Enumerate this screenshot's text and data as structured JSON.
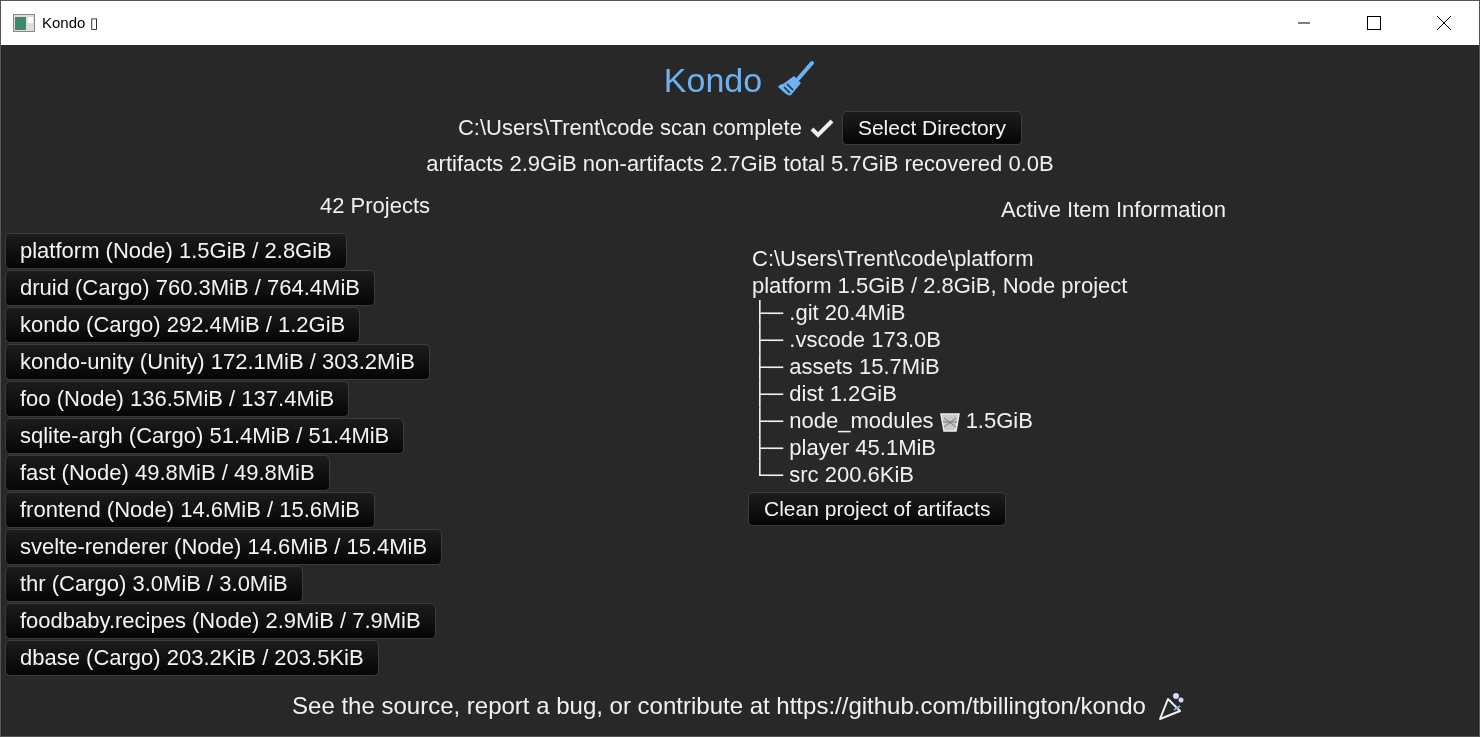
{
  "window": {
    "title": "Kondo ▯"
  },
  "header": {
    "title": "Kondo",
    "status": "C:\\Users\\Trent\\code scan complete",
    "scan_done": true,
    "select_button": "Select Directory",
    "summary": "artifacts 2.9GiB non-artifacts 2.7GiB total 5.7GiB recovered 0.0B"
  },
  "projects": {
    "heading": "42 Projects",
    "items": [
      {
        "label": "platform (Node) 1.5GiB / 2.8GiB"
      },
      {
        "label": "druid (Cargo) 760.3MiB / 764.4MiB"
      },
      {
        "label": "kondo (Cargo) 292.4MiB / 1.2GiB"
      },
      {
        "label": "kondo-unity (Unity) 172.1MiB / 303.2MiB"
      },
      {
        "label": "foo (Node) 136.5MiB / 137.4MiB"
      },
      {
        "label": "sqlite-argh (Cargo) 51.4MiB / 51.4MiB"
      },
      {
        "label": "fast (Node) 49.8MiB / 49.8MiB"
      },
      {
        "label": "frontend (Node) 14.6MiB / 15.6MiB"
      },
      {
        "label": "svelte-renderer (Node) 14.6MiB / 15.4MiB"
      },
      {
        "label": "thr (Cargo) 3.0MiB / 3.0MiB"
      },
      {
        "label": "foodbaby.recipes (Node) 2.9MiB / 7.9MiB"
      },
      {
        "label": "dbase (Cargo) 203.2KiB / 203.5KiB"
      }
    ]
  },
  "active_item": {
    "heading": "Active Item Information",
    "path": "C:\\Users\\Trent\\code\\platform",
    "summary": "platform 1.5GiB / 2.8GiB, Node project",
    "entries": [
      {
        "label": "├─ .git",
        "size": "20.4MiB",
        "artifact": false
      },
      {
        "label": "├─ .vscode",
        "size": "173.0B",
        "artifact": false
      },
      {
        "label": "├─ assets",
        "size": "15.7MiB",
        "artifact": false
      },
      {
        "label": "├─ dist",
        "size": "1.2GiB",
        "artifact": false
      },
      {
        "label": "├─ node_modules",
        "size": "1.5GiB",
        "artifact": true
      },
      {
        "label": "├─ player",
        "size": "45.1MiB",
        "artifact": false
      },
      {
        "label": "└─ src",
        "size": "200.6KiB",
        "artifact": false
      }
    ],
    "clean_button": "Clean project of artifacts"
  },
  "footer": {
    "text": "See the source, report a bug, or contribute at https://github.com/tbillington/kondo"
  }
}
